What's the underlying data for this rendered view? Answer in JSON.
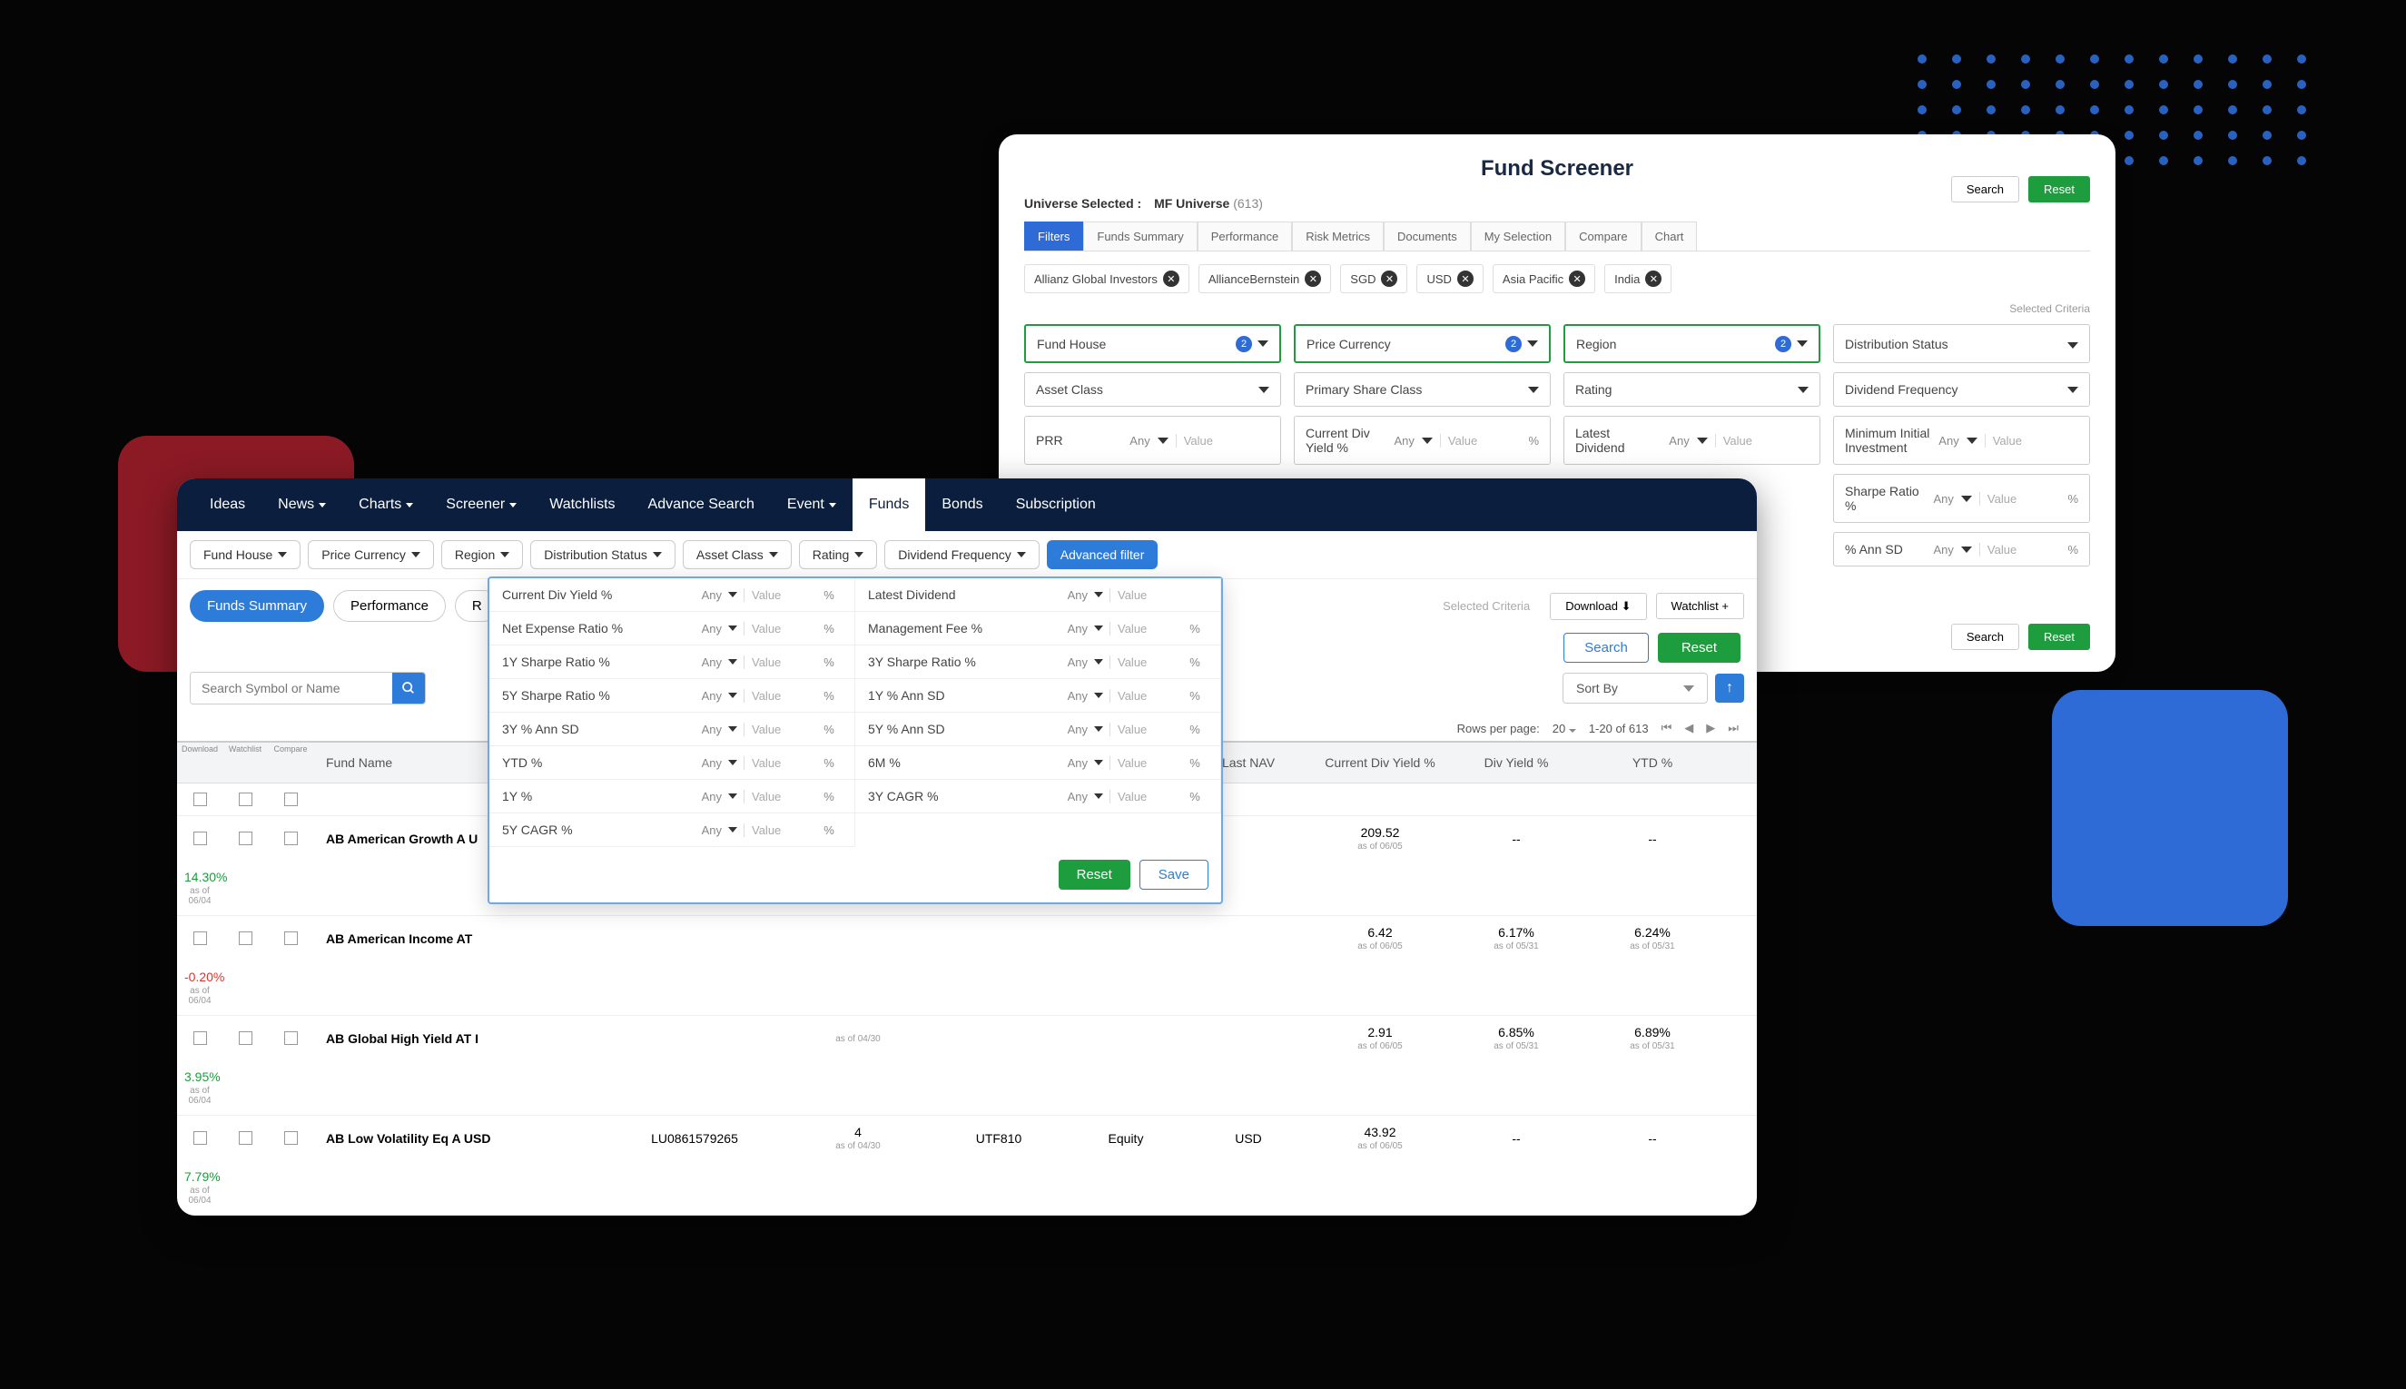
{
  "back": {
    "title": "Fund Screener",
    "universe_label": "Universe Selected :",
    "universe_value": "MF Universe",
    "universe_count": "(613)",
    "search": "Search",
    "reset": "Reset",
    "tabs": [
      "Filters",
      "Funds Summary",
      "Performance",
      "Risk Metrics",
      "Documents",
      "My Selection",
      "Compare",
      "Chart"
    ],
    "chips": [
      "Allianz Global Investors",
      "AllianceBernstein",
      "SGD",
      "USD",
      "Asia Pacific",
      "India"
    ],
    "selected_criteria": "Selected Criteria",
    "row1": [
      {
        "label": "Fund House",
        "badge": "2",
        "sel": true
      },
      {
        "label": "Price Currency",
        "badge": "2",
        "sel": true
      },
      {
        "label": "Region",
        "badge": "2",
        "sel": true
      },
      {
        "label": "Distribution Status"
      }
    ],
    "row2": [
      "Asset Class",
      "Primary Share Class",
      "Rating",
      "Dividend Frequency"
    ],
    "metrics": [
      [
        "PRR",
        "Current Div Yield %",
        "",
        "Latest Dividend",
        "Minimum Initial Investment"
      ],
      [
        "",
        "",
        "",
        "Sharpe Ratio %",
        ""
      ],
      [
        "",
        "",
        "",
        "% Ann SD",
        ""
      ]
    ],
    "metric_any": "Any",
    "metric_value": "Value",
    "metric_pct": "%"
  },
  "nav": {
    "items": [
      "Ideas",
      "News",
      "Charts",
      "Screener",
      "Watchlists",
      "Advance Search",
      "Event"
    ],
    "dropdown_idx": [
      1,
      2,
      3,
      6
    ],
    "active_tab": "Funds",
    "bonds": "Bonds",
    "subscription": "Subscription"
  },
  "filters": {
    "pills": [
      "Fund House",
      "Price Currency",
      "Region",
      "Distribution Status",
      "Asset Class",
      "Rating",
      "Dividend Frequency"
    ],
    "advanced": "Advanced filter"
  },
  "toolbar": {
    "tabs": [
      "Funds Summary",
      "Performance",
      "R"
    ],
    "download": "Download",
    "watchlist": "Watchlist  +",
    "selected_criteria": "Selected Criteria",
    "search": "Search",
    "reset": "Reset"
  },
  "search": {
    "placeholder": "Search Symbol or Name",
    "sort": "Sort By"
  },
  "pager": {
    "rows_label": "Rows per page:",
    "rows_value": "20",
    "range": "1-20 of 613"
  },
  "table": {
    "micro": [
      "Download",
      "Watchlist",
      "Compare"
    ],
    "headers": [
      "Fund Name",
      "",
      "",
      "",
      "",
      "Last NAV",
      "Current Div Yield %",
      "Div Yield %",
      "YTD %"
    ],
    "rows": [
      {
        "name": "AB American Growth A U",
        "isin": "",
        "rating": "",
        "rating_sub": "",
        "class": "",
        "asset": "",
        "ccy": "",
        "nav": "209.52",
        "nav_sub": "as of 06/05",
        "cdy": "--",
        "dy": "--",
        "ytd": "14.30%",
        "ytd_sub": "as of 06/04",
        "ytd_cls": "green"
      },
      {
        "name": "AB American Income AT",
        "isin": "",
        "rating": "",
        "rating_sub": "",
        "class": "",
        "asset": "",
        "ccy": "",
        "nav": "6.42",
        "nav_sub": "as of 06/05",
        "cdy": "6.17%",
        "cdy_sub": "as of 05/31",
        "dy": "6.24%",
        "dy_sub": "as of 05/31",
        "ytd": "-0.20%",
        "ytd_sub": "as of 06/04",
        "ytd_cls": "red"
      },
      {
        "name": "AB Global High Yield AT I",
        "isin": "",
        "rating": "",
        "rating_sub": "as of 04/30",
        "class": "",
        "asset": "",
        "ccy": "",
        "nav": "2.91",
        "nav_sub": "as of 06/05",
        "cdy": "6.85%",
        "cdy_sub": "as of 05/31",
        "dy": "6.89%",
        "dy_sub": "as of 05/31",
        "ytd": "3.95%",
        "ytd_sub": "as of 06/04",
        "ytd_cls": "green"
      },
      {
        "name": "AB Low Volatility Eq A USD",
        "isin": "LU0861579265",
        "rating": "4",
        "rating_sub": "as of 04/30",
        "class": "UTF810",
        "asset": "Equity",
        "ccy": "USD",
        "nav": "43.92",
        "nav_sub": "as of 06/05",
        "cdy": "--",
        "dy": "--",
        "ytd": "7.79%",
        "ytd_sub": "as of 06/04",
        "ytd_cls": "green"
      }
    ]
  },
  "adv": {
    "rows": [
      [
        "Current Div Yield %",
        "Latest Dividend"
      ],
      [
        "Net Expense Ratio %",
        "Management Fee %"
      ],
      [
        "1Y Sharpe Ratio %",
        "3Y Sharpe Ratio %"
      ],
      [
        "5Y Sharpe Ratio %",
        "1Y % Ann SD"
      ],
      [
        "3Y % Ann SD",
        "5Y % Ann SD"
      ],
      [
        "YTD %",
        "6M %"
      ],
      [
        "1Y %",
        "3Y CAGR %"
      ],
      [
        "5Y CAGR %",
        ""
      ]
    ],
    "any": "Any",
    "value": "Value",
    "pct": "%",
    "reset": "Reset",
    "save": "Save"
  }
}
